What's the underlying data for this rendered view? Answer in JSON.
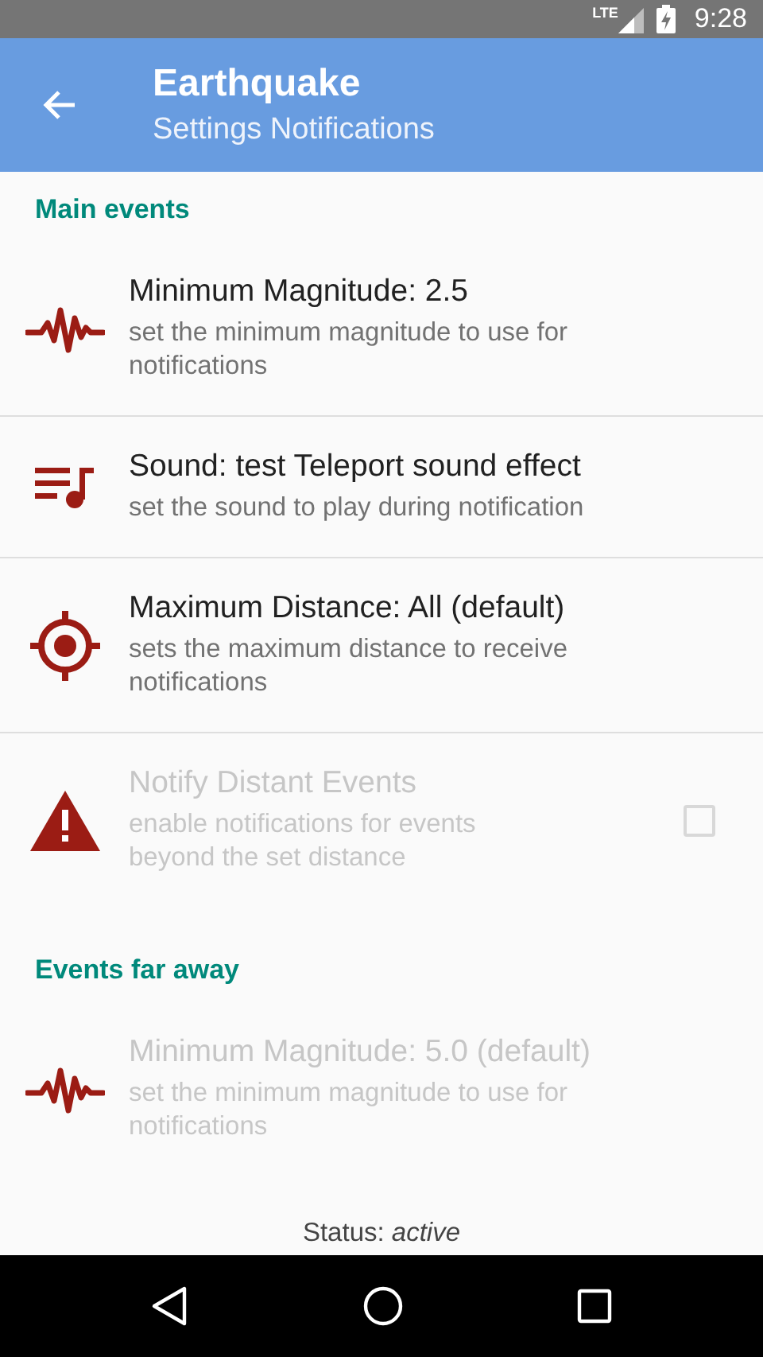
{
  "status_bar": {
    "network": "LTE",
    "time": "9:28"
  },
  "app_bar": {
    "title": "Earthquake",
    "subtitle": "Settings Notifications"
  },
  "sections": [
    {
      "header": "Main events",
      "items": [
        {
          "kind": "magnitude",
          "title": "Minimum Magnitude: 2.5",
          "summary": "set the minimum magnitude to use for notifications",
          "disabled": false
        },
        {
          "kind": "sound",
          "title": "Sound: test Teleport sound effect",
          "summary": "set the sound to play during notification",
          "disabled": false
        },
        {
          "kind": "distance",
          "title": "Maximum Distance: All (default)",
          "summary": "sets the maximum distance to receive notifications",
          "disabled": false
        },
        {
          "kind": "toggle",
          "title": "Notify Distant Events",
          "summary": "enable notifications for events beyond the set distance",
          "disabled": true,
          "checked": false
        }
      ]
    },
    {
      "header": "Events far away",
      "items": [
        {
          "kind": "magnitude",
          "title": "Minimum Magnitude: 5.0 (default)",
          "summary": "set the minimum magnitude to use for notifications",
          "disabled": true
        }
      ]
    }
  ],
  "footer": "Status: *active*"
}
